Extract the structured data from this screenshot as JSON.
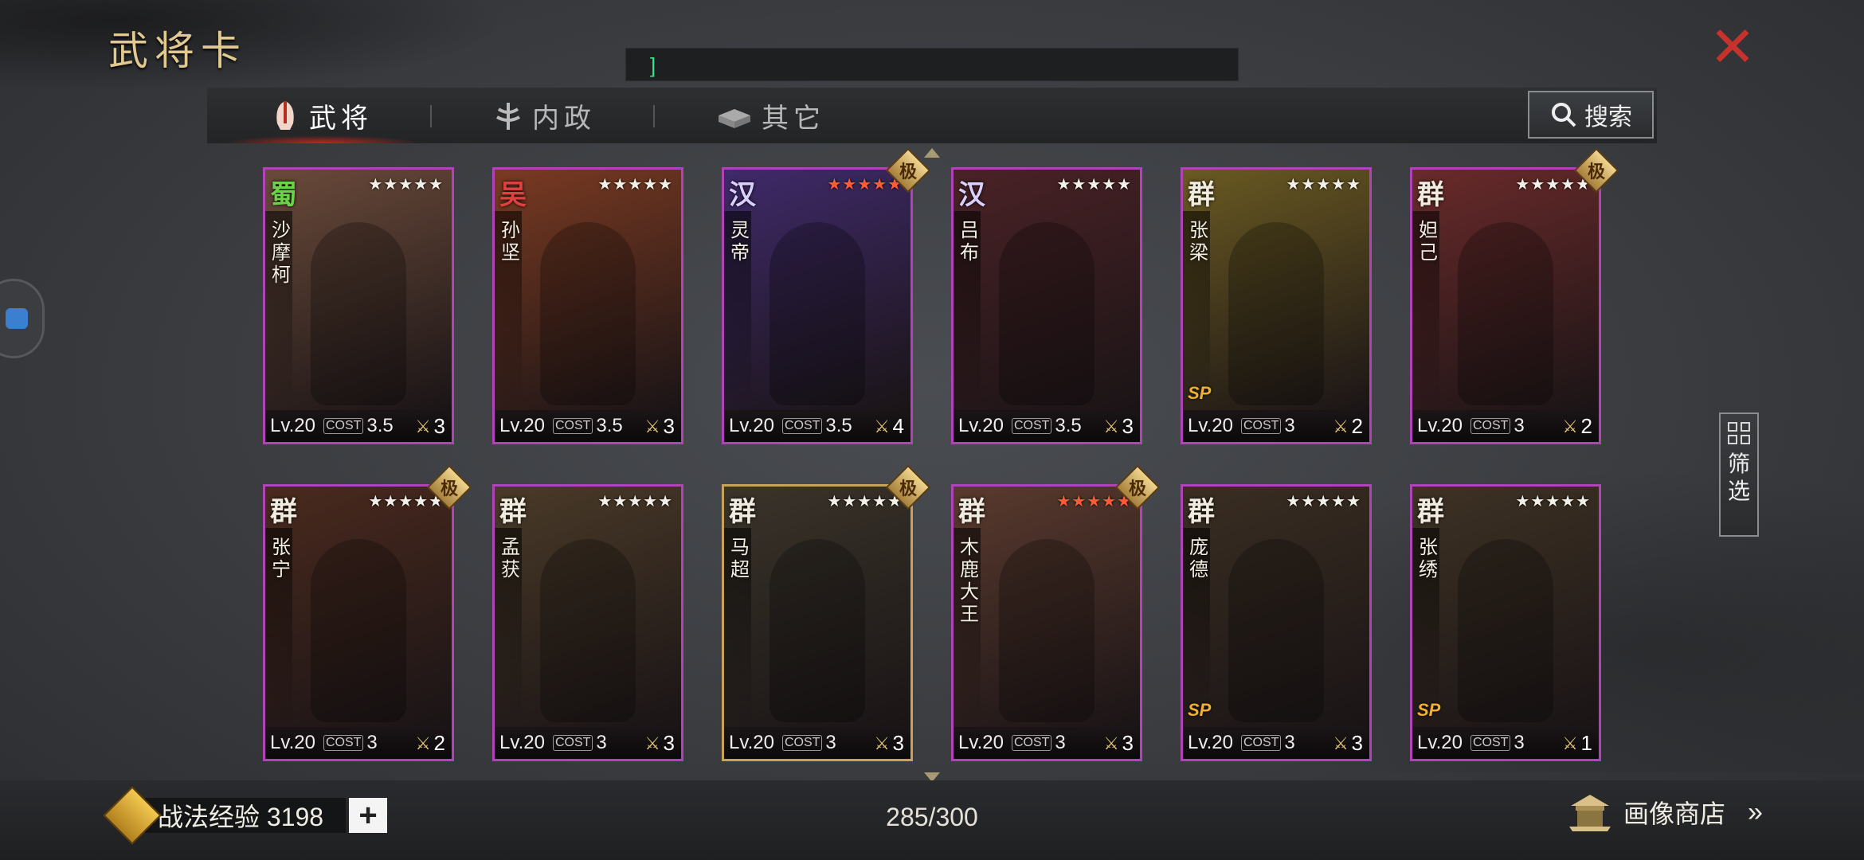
{
  "title": "武将卡",
  "input": {
    "caret": "]"
  },
  "close_label": "✕",
  "tabs": [
    {
      "label": "武将",
      "active": true,
      "icon": "helmet-icon"
    },
    {
      "label": "内政",
      "active": false,
      "icon": "tree-icon"
    },
    {
      "label": "其它",
      "active": false,
      "icon": "box-icon"
    }
  ],
  "search_label": "搜索",
  "filter_label": "筛选",
  "cards": [
    {
      "faction": "蜀",
      "faction_color": "#6bd24a",
      "name": "沙摩柯",
      "stars": "★★★★★",
      "star_color": "white",
      "level": "Lv.20",
      "cost_label": "COST",
      "cost": "3.5",
      "count": "3",
      "bg": "#6a4a3a",
      "badge": "",
      "sp": ""
    },
    {
      "faction": "吴",
      "faction_color": "#e04040",
      "name": "孙坚",
      "stars": "★★★★★",
      "star_color": "white",
      "level": "Lv.20",
      "cost_label": "COST",
      "cost": "3.5",
      "count": "3",
      "bg": "#7a3a22",
      "badge": "",
      "sp": ""
    },
    {
      "faction": "汉",
      "faction_color": "#d8d0ff",
      "name": "灵帝",
      "stars": "★★★★★",
      "star_color": "red",
      "level": "Lv.20",
      "cost_label": "COST",
      "cost": "3.5",
      "count": "4",
      "bg": "#3f2a6a",
      "badge": "极",
      "sp": ""
    },
    {
      "faction": "汉",
      "faction_color": "#d8d0ff",
      "name": "吕布",
      "stars": "★★★★★",
      "star_color": "white",
      "level": "Lv.20",
      "cost_label": "COST",
      "cost": "3.5",
      "count": "3",
      "bg": "#4a2226",
      "badge": "",
      "sp": ""
    },
    {
      "faction": "群",
      "faction_color": "#f0ece0",
      "name": "张梁",
      "stars": "★★★★★",
      "star_color": "white",
      "level": "Lv.20",
      "cost_label": "COST",
      "cost": "3",
      "count": "2",
      "bg": "#6a5a22",
      "badge": "",
      "sp": "SP"
    },
    {
      "faction": "群",
      "faction_color": "#f0ece0",
      "name": "妲己",
      "stars": "★★★★★",
      "star_color": "white",
      "level": "Lv.20",
      "cost_label": "COST",
      "cost": "3",
      "count": "2",
      "bg": "#6a2a2a",
      "badge": "极",
      "sp": ""
    },
    {
      "faction": "群",
      "faction_color": "#f0ece0",
      "name": "张宁",
      "stars": "★★★★★",
      "star_color": "white",
      "level": "Lv.20",
      "cost_label": "COST",
      "cost": "3",
      "count": "2",
      "bg": "#4a2a1e",
      "badge": "极",
      "sp": ""
    },
    {
      "faction": "群",
      "faction_color": "#f0ece0",
      "name": "孟获",
      "stars": "★★★★★",
      "star_color": "white",
      "level": "Lv.20",
      "cost_label": "COST",
      "cost": "3",
      "count": "3",
      "bg": "#4a3a28",
      "badge": "",
      "sp": ""
    },
    {
      "faction": "群",
      "faction_color": "#f0ece0",
      "name": "马超",
      "stars": "★★★★★",
      "star_color": "white",
      "level": "Lv.20",
      "cost_label": "COST",
      "cost": "3",
      "count": "3",
      "bg": "#3a342a",
      "badge": "极",
      "sp": ""
    },
    {
      "faction": "群",
      "faction_color": "#f0ece0",
      "name": "木鹿大王",
      "stars": "★★★★★",
      "star_color": "red",
      "level": "Lv.20",
      "cost_label": "COST",
      "cost": "3",
      "count": "3",
      "bg": "#5a3a2e",
      "badge": "极",
      "sp": ""
    },
    {
      "faction": "群",
      "faction_color": "#f0ece0",
      "name": "庞德",
      "stars": "★★★★★",
      "star_color": "white",
      "level": "Lv.20",
      "cost_label": "COST",
      "cost": "3",
      "count": "3",
      "bg": "#3a2e22",
      "badge": "",
      "sp": "SP"
    },
    {
      "faction": "群",
      "faction_color": "#f0ece0",
      "name": "张绣",
      "stars": "★★★★★",
      "star_color": "white",
      "level": "Lv.20",
      "cost_label": "COST",
      "cost": "3",
      "count": "1",
      "bg": "#3e3224",
      "badge": "",
      "sp": "SP"
    }
  ],
  "footer": {
    "exp_label": "战法经验 3198",
    "plus": "+",
    "page_count": "285/300",
    "shop_label": "画像商店",
    "shop_chevron": "»"
  }
}
